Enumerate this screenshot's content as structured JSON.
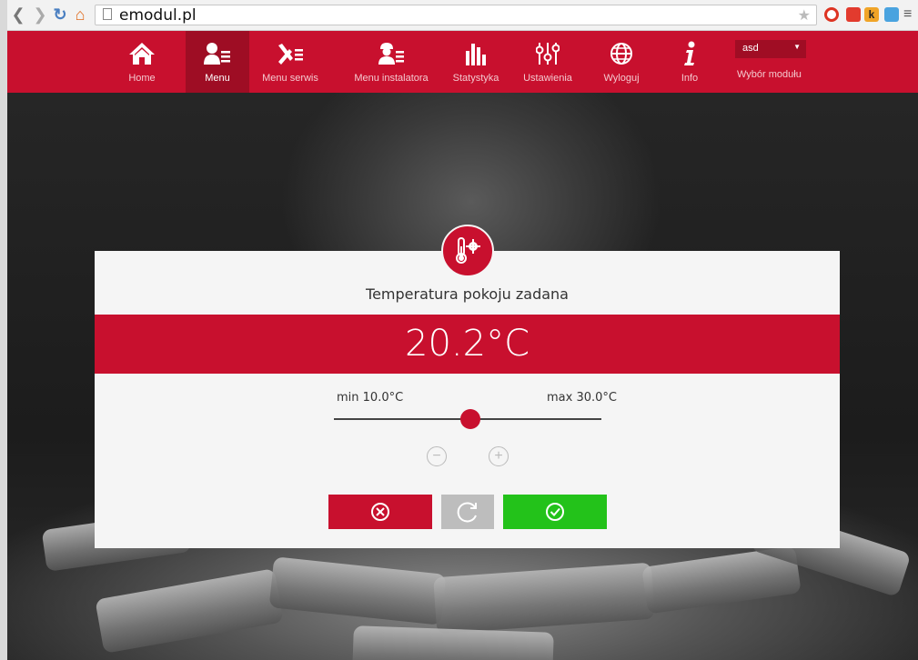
{
  "browser": {
    "url": "emodul.pl"
  },
  "nav": {
    "items": [
      {
        "label": "Home",
        "icon": "home-icon"
      },
      {
        "label": "Menu",
        "icon": "user-menu-icon",
        "active": true
      },
      {
        "label": "Menu serwis",
        "icon": "tools-icon"
      },
      {
        "label": "Menu instalatora",
        "icon": "installer-icon"
      },
      {
        "label": "Statystyka",
        "icon": "bar-chart-icon"
      },
      {
        "label": "Ustawienia",
        "icon": "sliders-icon"
      },
      {
        "label": "Wyloguj",
        "icon": "globe-icon"
      },
      {
        "label": "Info",
        "icon": "info-icon"
      }
    ],
    "module_select_value": "asd",
    "module_label": "Wybór modułu"
  },
  "modal": {
    "title": "Temperatura pokoju zadana",
    "value": "20.2°C",
    "min_label": "min 10.0°C",
    "max_label": "max 30.0°C",
    "slider_fraction": 0.51
  },
  "colors": {
    "accent": "#c8102e",
    "confirm": "#23c21a",
    "reset": "#bdbdbd"
  }
}
